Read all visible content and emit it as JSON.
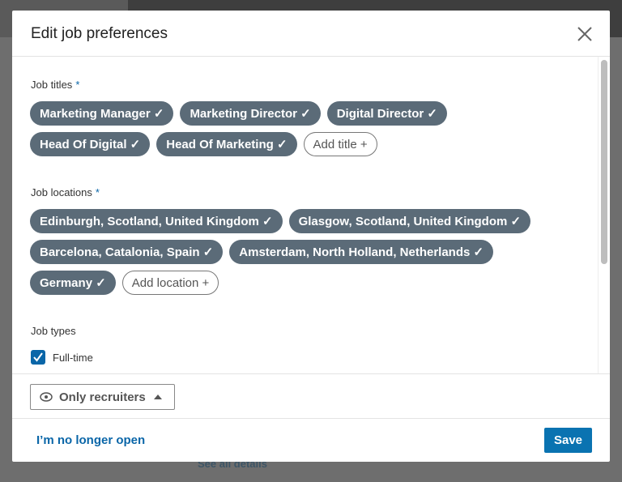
{
  "background": {
    "see_all_details": "See all details"
  },
  "modal": {
    "title": "Edit job preferences",
    "close_icon": "close-icon",
    "job_titles": {
      "label": "Job titles",
      "required_mark": "*",
      "chips": [
        "Marketing Manager ✓",
        "Marketing Director ✓",
        "Digital Director ✓",
        "Head Of Digital ✓",
        "Head Of Marketing ✓"
      ],
      "add_label": "Add title +"
    },
    "job_locations": {
      "label": "Job locations",
      "required_mark": "*",
      "chips": [
        "Edinburgh, Scotland, United Kingdom ✓",
        "Glasgow, Scotland, United Kingdom ✓",
        "Barcelona, Catalonia, Spain ✓",
        "Amsterdam, North Holland, Netherlands ✓",
        "Germany ✓"
      ],
      "add_label": "Add location +"
    },
    "job_types": {
      "label": "Job types",
      "options": [
        {
          "label": "Full-time",
          "checked": true
        }
      ]
    },
    "visibility": {
      "icon": "eye-icon",
      "label": "Only recruiters"
    },
    "footer": {
      "no_longer_open": "I’m no longer open",
      "save": "Save"
    }
  },
  "colors": {
    "accent": "#0a66a8",
    "chip": "#5b6b78"
  }
}
